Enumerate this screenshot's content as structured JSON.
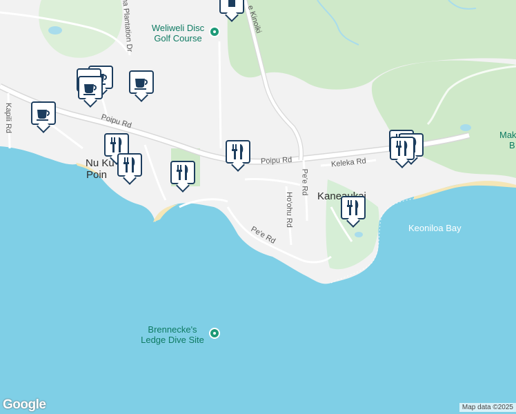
{
  "map": {
    "roads": {
      "poipu_rd": "Poipu Rd",
      "poipu_rd_2": "Poipu Rd",
      "kapili_rd": "Kapili Rd",
      "keleka_rd": "Keleka Rd",
      "pee_rd": "Pe'e Rd",
      "pee_rd_2": "Pe'e Rd",
      "hoohu_rd": "Ho'ohu Rd",
      "kinoiki": "e Kinoiki",
      "plantation_dr": "na Plantation Dr"
    },
    "places": {
      "nukumoi_1": "Nu Ku",
      "nukumoi_2": "Poin",
      "kaneaukai": "Kaneaukai",
      "keoniloa": "Keoniloa Bay",
      "mak_1": "Mak",
      "mak_2": "B"
    },
    "pois": {
      "golf_1": "Weliweli Disc",
      "golf_2": "Golf Course",
      "dive_1": "Brennecke's",
      "dive_2": "Ledge Dive Site"
    },
    "markers": [
      {
        "name": "cafe-marker",
        "icon": "coffee-cup-icon"
      },
      {
        "name": "cafe-marker",
        "icon": "coffee-cup-icon"
      },
      {
        "name": "cafe-marker",
        "icon": "coffee-cup-icon"
      },
      {
        "name": "cafe-marker",
        "icon": "coffee-cup-icon"
      },
      {
        "name": "restaurant-marker",
        "icon": "fork-knife-icon"
      },
      {
        "name": "restaurant-marker",
        "icon": "fork-knife-icon"
      },
      {
        "name": "restaurant-marker",
        "icon": "fork-knife-icon"
      },
      {
        "name": "restaurant-marker",
        "icon": "fork-knife-icon"
      },
      {
        "name": "restaurant-marker",
        "icon": "fork-knife-icon"
      },
      {
        "name": "restaurant-marker",
        "icon": "fork-knife-icon"
      }
    ],
    "colors": {
      "water": "#7fcfe6",
      "land": "#f2f2f2",
      "park": "#cfe9c9",
      "road": "#ffffff",
      "marker_border": "#1c3d5e",
      "poi_green": "#1e9a78"
    },
    "attribution": "Map data ©2025",
    "logo": "Google"
  }
}
